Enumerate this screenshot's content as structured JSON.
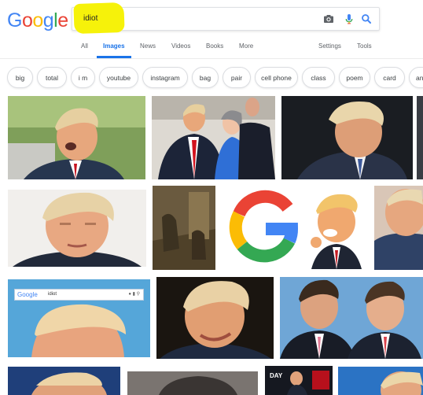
{
  "header": {
    "logo": [
      "G",
      "o",
      "o",
      "g",
      "l",
      "e"
    ],
    "logo_colors": [
      "#4285f4",
      "#ea4335",
      "#fbbc05",
      "#4285f4",
      "#34a853",
      "#ea4335"
    ],
    "search_value": "idiot",
    "icons": [
      "camera-icon",
      "microphone-icon",
      "search-icon"
    ]
  },
  "tabs": {
    "all": "All",
    "images": "Images",
    "news": "News",
    "videos": "Videos",
    "books": "Books",
    "more": "More",
    "settings": "Settings",
    "tools": "Tools"
  },
  "chips": [
    "big",
    "total",
    "i m",
    "youtube",
    "instagram",
    "bag",
    "pair",
    "cell phone",
    "class",
    "poem",
    "card",
    "an"
  ],
  "results": {
    "embedded_screenshot_logo": "Google",
    "embedded_screenshot_query": "idiot",
    "poster_text": "DAY"
  },
  "colors": {
    "accent": "#1a73e8",
    "highlight": "#f6f20a",
    "g_blue": "#4285f4",
    "g_red": "#ea4335",
    "g_yellow": "#fbbc05",
    "g_green": "#34a853"
  }
}
